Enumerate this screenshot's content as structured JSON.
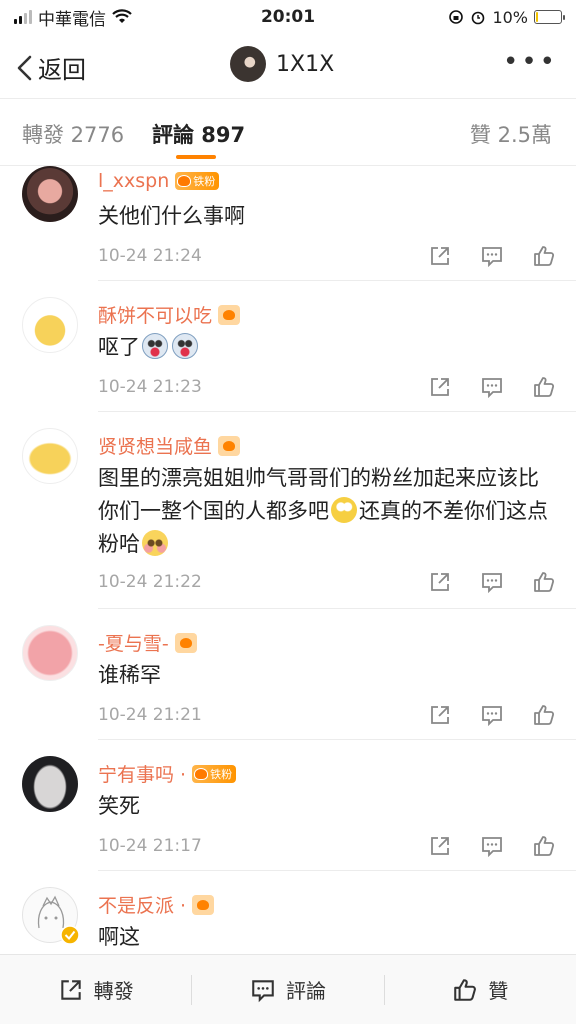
{
  "status_bar": {
    "carrier": "中華電信",
    "time": "20:01",
    "battery": "10%",
    "battery_level": 0.1
  },
  "nav": {
    "back_label": "返回",
    "title": "1X1X"
  },
  "tabs": [
    {
      "label": "轉發 2776"
    },
    {
      "label": "評論 897"
    },
    {
      "label": "贊 2.5萬"
    }
  ],
  "comments": [
    {
      "username": "l_xxspn",
      "badge": "铁粉",
      "text": "关他们什么事啊",
      "time": "10-24 21:24"
    },
    {
      "username": "酥饼不可以吃",
      "text": "呕了",
      "time": "10-24 21:23"
    },
    {
      "username": "贤贤想当咸鱼",
      "text_part1": "图里的漂亮姐姐帅气哥哥们的粉丝加起来应该比你们一整个国的人都多吧",
      "text_part2": "还真的不差你们这点粉哈",
      "time": "10-24 21:22"
    },
    {
      "username": "-夏与雪-",
      "text": "谁稀罕",
      "time": "10-24 21:21"
    },
    {
      "username": "宁有事吗 ·",
      "badge": "铁粉",
      "text": "笑死",
      "time": "10-24 21:17"
    },
    {
      "username": "不是反派 ·",
      "text": "啊这"
    }
  ],
  "bottom_bar": {
    "repost_label": "轉發",
    "comment_label": "評論",
    "like_label": "贊"
  },
  "colors": {
    "accent": "#ff8200",
    "username": "#eb7350",
    "timestamp": "#a6a6a6"
  }
}
